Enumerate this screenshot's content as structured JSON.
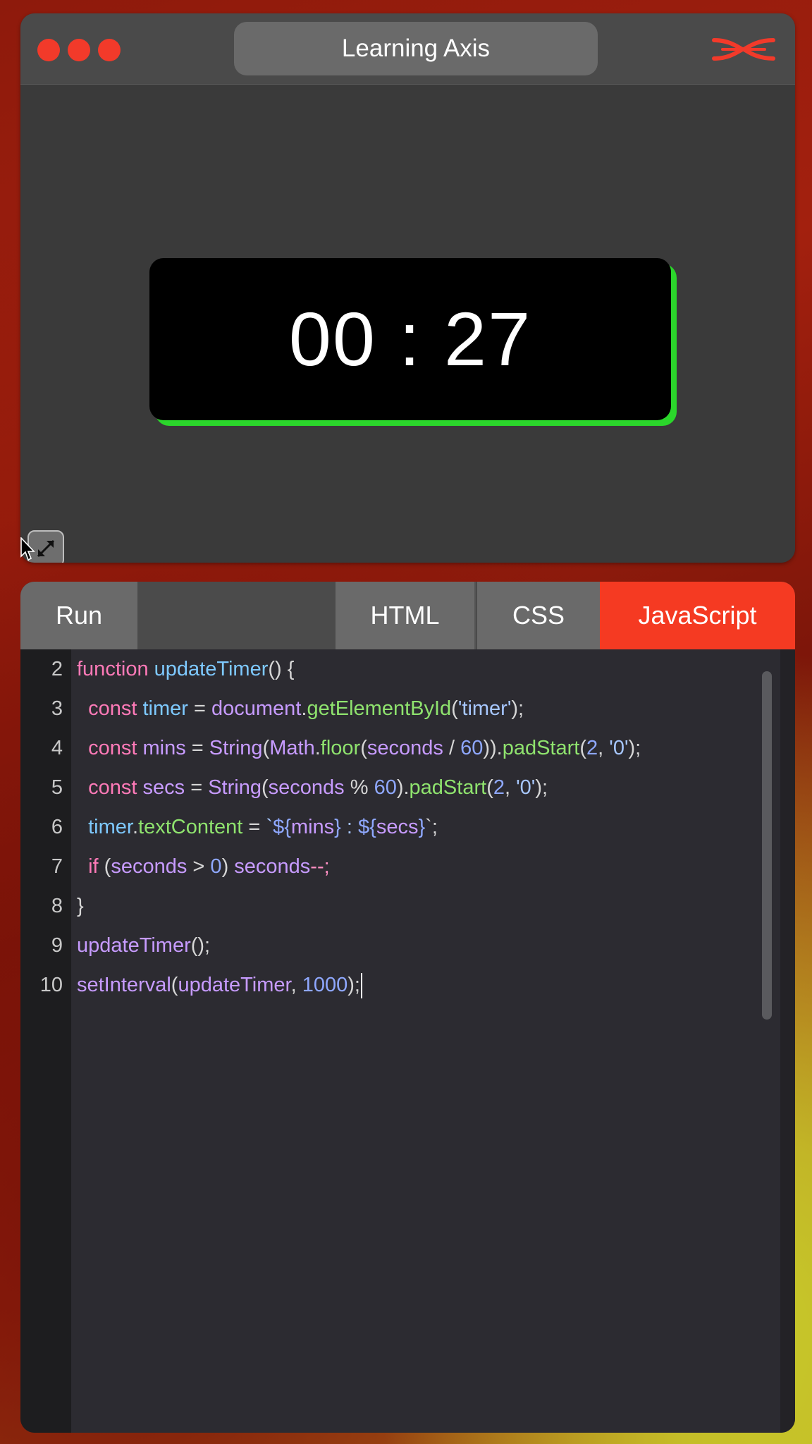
{
  "window": {
    "title": "Learning Axis"
  },
  "preview": {
    "timer_text": "00 : 27"
  },
  "editor": {
    "tabs": {
      "run": "Run",
      "html": "HTML",
      "css": "CSS",
      "javascript": "JavaScript"
    },
    "active_tab": "JavaScript",
    "line_numbers": [
      "2",
      "3",
      "4",
      "5",
      "6",
      "7",
      "8",
      "9",
      "10"
    ],
    "code": [
      [
        {
          "t": "function ",
          "c": "k"
        },
        {
          "t": "updateTimer",
          "c": "f"
        },
        {
          "t": "() {",
          "c": "p"
        }
      ],
      [
        {
          "t": "  const ",
          "c": "k"
        },
        {
          "t": "timer",
          "c": "f"
        },
        {
          "t": " = ",
          "c": "p"
        },
        {
          "t": "document",
          "c": "v"
        },
        {
          "t": ".",
          "c": "p"
        },
        {
          "t": "getElementById",
          "c": "m"
        },
        {
          "t": "(",
          "c": "p"
        },
        {
          "t": "'timer'",
          "c": "s"
        },
        {
          "t": ");",
          "c": "p"
        }
      ],
      [
        {
          "t": "  const ",
          "c": "k"
        },
        {
          "t": "mins",
          "c": "v"
        },
        {
          "t": " = ",
          "c": "p"
        },
        {
          "t": "String",
          "c": "v"
        },
        {
          "t": "(",
          "c": "p"
        },
        {
          "t": "Math",
          "c": "v"
        },
        {
          "t": ".",
          "c": "p"
        },
        {
          "t": "floor",
          "c": "m"
        },
        {
          "t": "(",
          "c": "p"
        },
        {
          "t": "seconds",
          "c": "v"
        },
        {
          "t": " / ",
          "c": "p"
        },
        {
          "t": "60",
          "c": "n"
        },
        {
          "t": ")).",
          "c": "p"
        },
        {
          "t": "padStart",
          "c": "m"
        },
        {
          "t": "(",
          "c": "p"
        },
        {
          "t": "2",
          "c": "n"
        },
        {
          "t": ", ",
          "c": "p"
        },
        {
          "t": "'0'",
          "c": "s"
        },
        {
          "t": ");",
          "c": "p"
        }
      ],
      [
        {
          "t": "  const ",
          "c": "k"
        },
        {
          "t": "secs",
          "c": "v"
        },
        {
          "t": " = ",
          "c": "p"
        },
        {
          "t": "String",
          "c": "v"
        },
        {
          "t": "(",
          "c": "p"
        },
        {
          "t": "seconds",
          "c": "v"
        },
        {
          "t": " % ",
          "c": "p"
        },
        {
          "t": "60",
          "c": "n"
        },
        {
          "t": ").",
          "c": "p"
        },
        {
          "t": "padStart",
          "c": "m"
        },
        {
          "t": "(",
          "c": "p"
        },
        {
          "t": "2",
          "c": "n"
        },
        {
          "t": ", ",
          "c": "p"
        },
        {
          "t": "'0'",
          "c": "s"
        },
        {
          "t": ");",
          "c": "p"
        }
      ],
      [
        {
          "t": "  timer",
          "c": "f"
        },
        {
          "t": ".",
          "c": "p"
        },
        {
          "t": "textContent",
          "c": "m"
        },
        {
          "t": " = ",
          "c": "p"
        },
        {
          "t": "`",
          "c": "s"
        },
        {
          "t": "${",
          "c": "n"
        },
        {
          "t": "mins",
          "c": "v"
        },
        {
          "t": "}",
          "c": "n"
        },
        {
          "t": " : ",
          "c": "s"
        },
        {
          "t": "${",
          "c": "n"
        },
        {
          "t": "secs",
          "c": "v"
        },
        {
          "t": "}",
          "c": "n"
        },
        {
          "t": "`;",
          "c": "p"
        }
      ],
      [
        {
          "t": "  if ",
          "c": "k"
        },
        {
          "t": "(",
          "c": "p"
        },
        {
          "t": "seconds",
          "c": "v"
        },
        {
          "t": " > ",
          "c": "p"
        },
        {
          "t": "0",
          "c": "n"
        },
        {
          "t": ") ",
          "c": "p"
        },
        {
          "t": "seconds",
          "c": "v"
        },
        {
          "t": "--;",
          "c": "o"
        }
      ],
      [
        {
          "t": "}",
          "c": "p"
        }
      ],
      [
        {
          "t": "updateTimer",
          "c": "v"
        },
        {
          "t": "();",
          "c": "p"
        }
      ],
      [
        {
          "t": "setInterval",
          "c": "v"
        },
        {
          "t": "(",
          "c": "p"
        },
        {
          "t": "updateTimer",
          "c": "v"
        },
        {
          "t": ", ",
          "c": "p"
        },
        {
          "t": "1000",
          "c": "n"
        },
        {
          "t": ");",
          "c": "p"
        }
      ]
    ]
  },
  "colors": {
    "accent": "#f53a22",
    "timer_glow": "#2bd62b",
    "traffic_light": "#f23a2a"
  },
  "icons": {
    "logo": "learning-axis-logo-icon",
    "expand": "expand-arrows-icon",
    "cursor": "mouse-pointer-icon"
  }
}
